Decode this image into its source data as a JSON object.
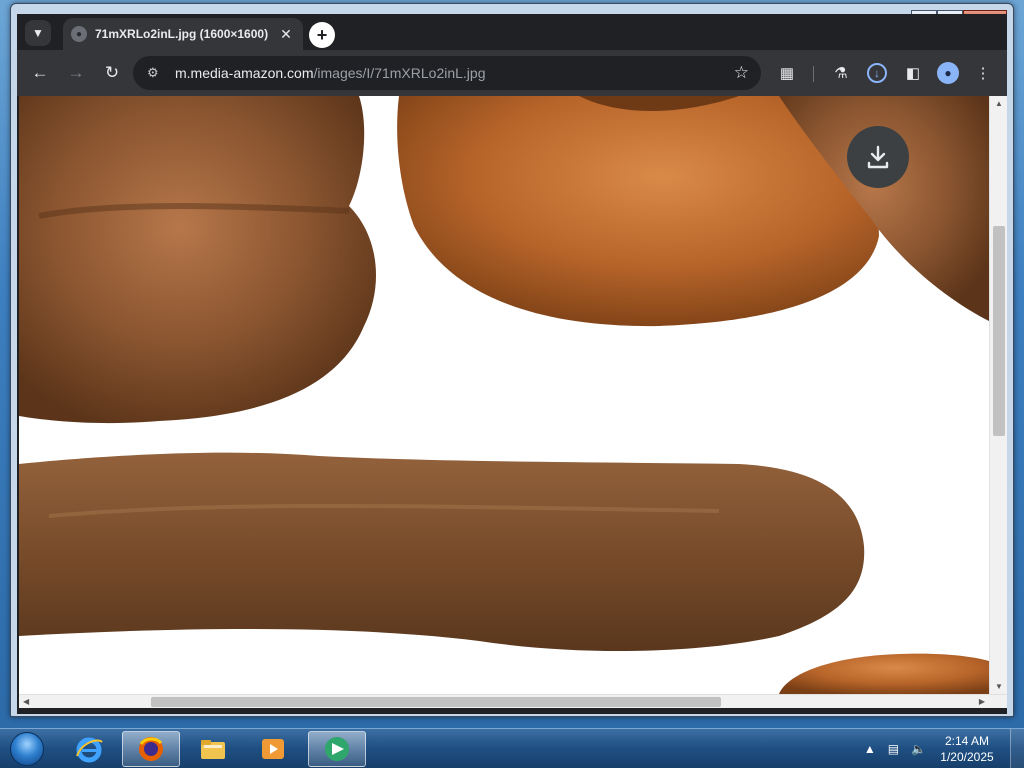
{
  "browser": {
    "tab": {
      "title": "71mXRLo2inL.jpg (1600×1600)"
    },
    "address": {
      "host": "m.media-amazon.com",
      "path": "/images/I/71mXRLo2inL.jpg"
    }
  },
  "taskbar": {
    "clock": {
      "time": "2:14 AM",
      "date": "1/20/2025"
    }
  },
  "colors": {
    "chrome_dark": "#202124",
    "chrome_toolbar": "#35363a",
    "accent_blue": "#8ab4f8",
    "taskbar_blue": "#1f4f82"
  }
}
